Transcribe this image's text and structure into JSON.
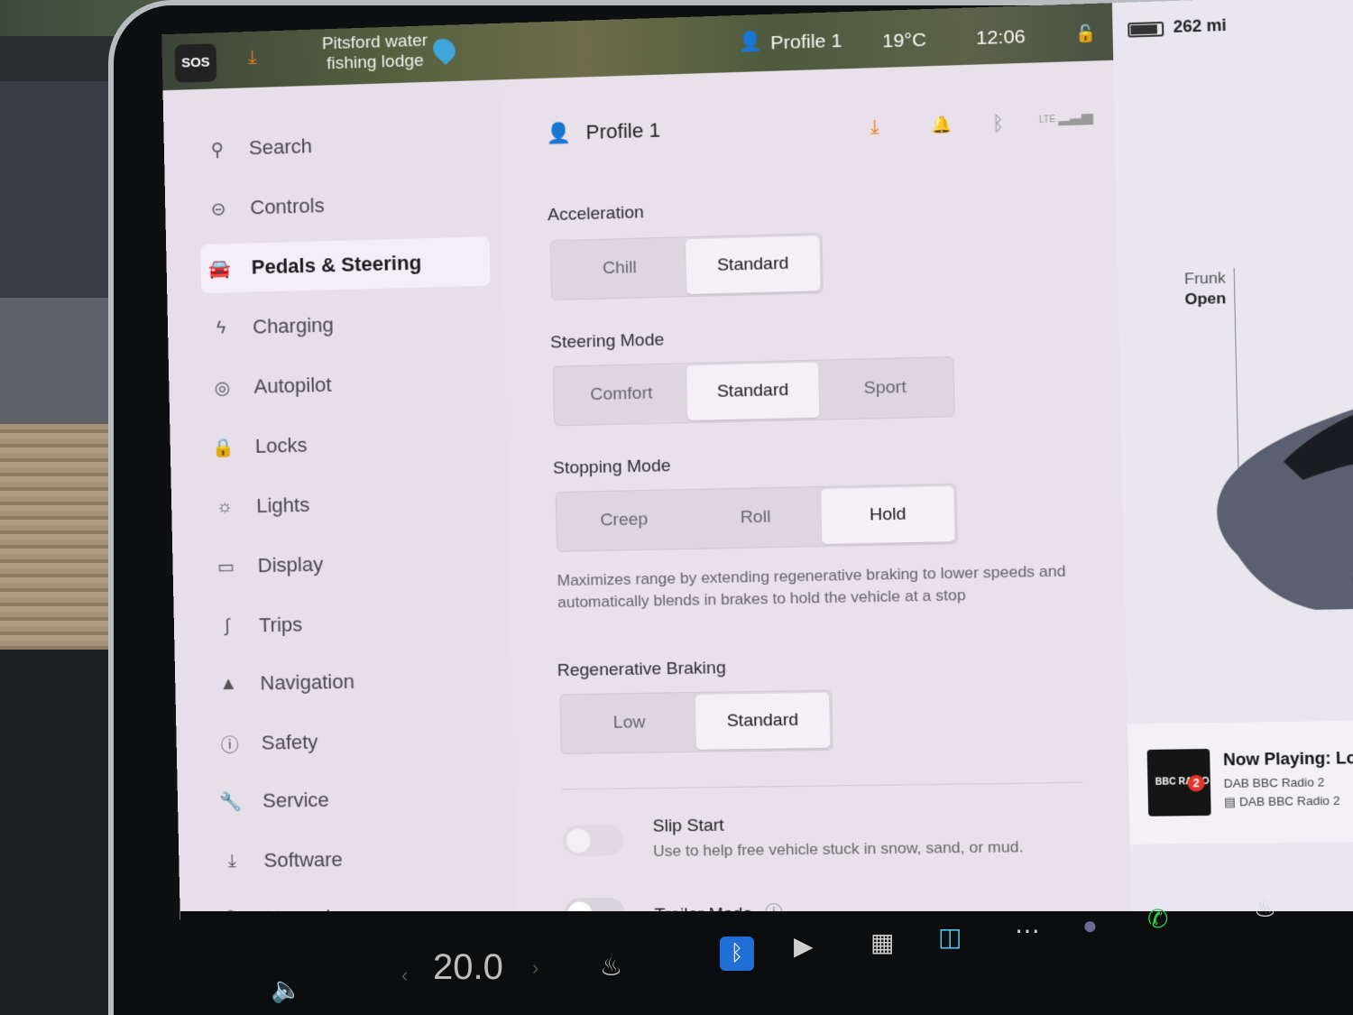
{
  "status_bar": {
    "sos_label": "SOS",
    "location_line1": "Pitsford water",
    "location_line2": "fishing lodge",
    "profile_name": "Profile 1",
    "temperature": "19°C",
    "time": "12:06",
    "range": "262 mi"
  },
  "sidebar": {
    "items": [
      {
        "label": "Search",
        "icon": "search-icon"
      },
      {
        "label": "Controls",
        "icon": "toggle-icon"
      },
      {
        "label": "Pedals & Steering",
        "icon": "car-icon",
        "active": true
      },
      {
        "label": "Charging",
        "icon": "bolt-icon"
      },
      {
        "label": "Autopilot",
        "icon": "steering-wheel-icon"
      },
      {
        "label": "Locks",
        "icon": "lock-icon"
      },
      {
        "label": "Lights",
        "icon": "sun-icon"
      },
      {
        "label": "Display",
        "icon": "display-icon"
      },
      {
        "label": "Trips",
        "icon": "trips-icon"
      },
      {
        "label": "Navigation",
        "icon": "navigation-arrow-icon"
      },
      {
        "label": "Safety",
        "icon": "alert-circle-icon"
      },
      {
        "label": "Service",
        "icon": "wrench-icon"
      },
      {
        "label": "Software",
        "icon": "download-icon"
      },
      {
        "label": "Upgrades",
        "icon": "shopping-bag-icon"
      }
    ]
  },
  "main": {
    "profile_name": "Profile 1",
    "header_icons": [
      "download-icon",
      "bell-icon",
      "bluetooth-icon",
      "lte-signal-icon"
    ],
    "lte_label": "LTE",
    "acceleration": {
      "label": "Acceleration",
      "options": [
        "Chill",
        "Standard"
      ],
      "selected": "Standard"
    },
    "steering_mode": {
      "label": "Steering Mode",
      "options": [
        "Comfort",
        "Standard",
        "Sport"
      ],
      "selected": "Standard"
    },
    "stopping_mode": {
      "label": "Stopping Mode",
      "options": [
        "Creep",
        "Roll",
        "Hold"
      ],
      "selected": "Hold",
      "description": "Maximizes range by extending regenerative braking to lower speeds and automatically blends in brakes to hold the vehicle at a stop"
    },
    "regen_braking": {
      "label": "Regenerative Braking",
      "options": [
        "Low",
        "Standard"
      ],
      "selected": "Standard"
    },
    "slip_start": {
      "label": "Slip Start",
      "description": "Use to help free vehicle stuck in snow, sand, or mud.",
      "enabled": false
    },
    "trailer_mode": {
      "label": "Trailer Mode",
      "enabled": false
    }
  },
  "vehicle_panel": {
    "frunk_line1": "Frunk",
    "frunk_line2": "Open"
  },
  "now_playing": {
    "title": "Now Playing: Locomo",
    "line1": "DAB BBC Radio 2",
    "line2": "DAB BBC Radio 2",
    "logo_text": "BBC RADIO",
    "logo_number": "2"
  },
  "dock": {
    "temperature": "20.0"
  },
  "colors": {
    "accent_orange": "#f07a1f",
    "bluetooth_blue": "#1f6fd6",
    "bbc_red": "#e3342d"
  }
}
